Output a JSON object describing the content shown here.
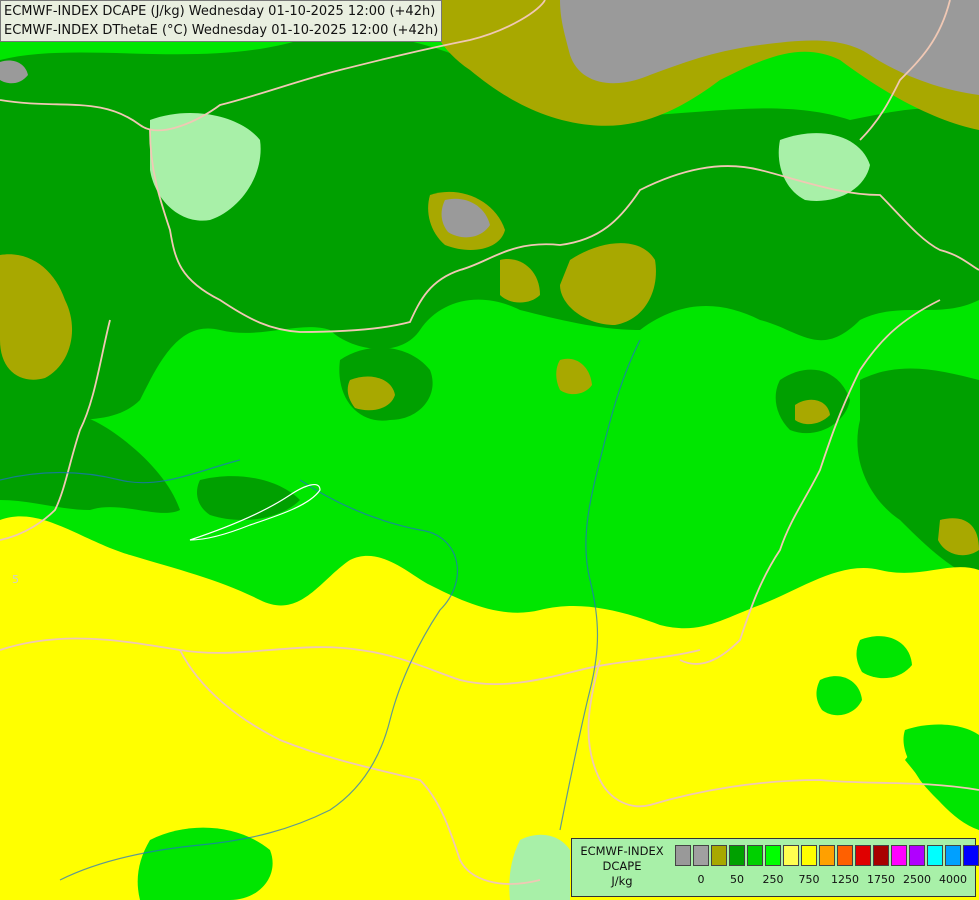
{
  "title": {
    "line1": "ECMWF-INDEX DCAPE (J/kg) Wednesday 01-10-2025 12:00 (+42h)",
    "line2": "ECMWF-INDEX DThetaE (°C) Wednesday 01-10-2025 12:00 (+42h)"
  },
  "map": {
    "contour_label": "5",
    "colors": {
      "gray": "#9a9a9a",
      "olive": "#a8a800",
      "dark_green": "#00a000",
      "green": "#00e600",
      "light_green": "#a8f0a8",
      "yellow": "#ffff00",
      "border": "#f0c8b4",
      "river": "#1e6ecc"
    }
  },
  "legend": {
    "name_line1": "ECMWF-INDEX",
    "name_line2": "DCAPE",
    "unit": "J/kg",
    "swatches": [
      "#999999",
      "#a0a0a0",
      "#a8a800",
      "#00a000",
      "#00d000",
      "#00ff00",
      "#ffff50",
      "#ffff00",
      "#ffa000",
      "#ff6000",
      "#e00000",
      "#a80000",
      "#ff00ff",
      "#b000ff",
      "#00ffff",
      "#00a0ff",
      "#0000ff",
      "#000080"
    ],
    "ticks": [
      "0",
      "50",
      "250",
      "750",
      "1250",
      "1750",
      "2500",
      "4000"
    ]
  }
}
